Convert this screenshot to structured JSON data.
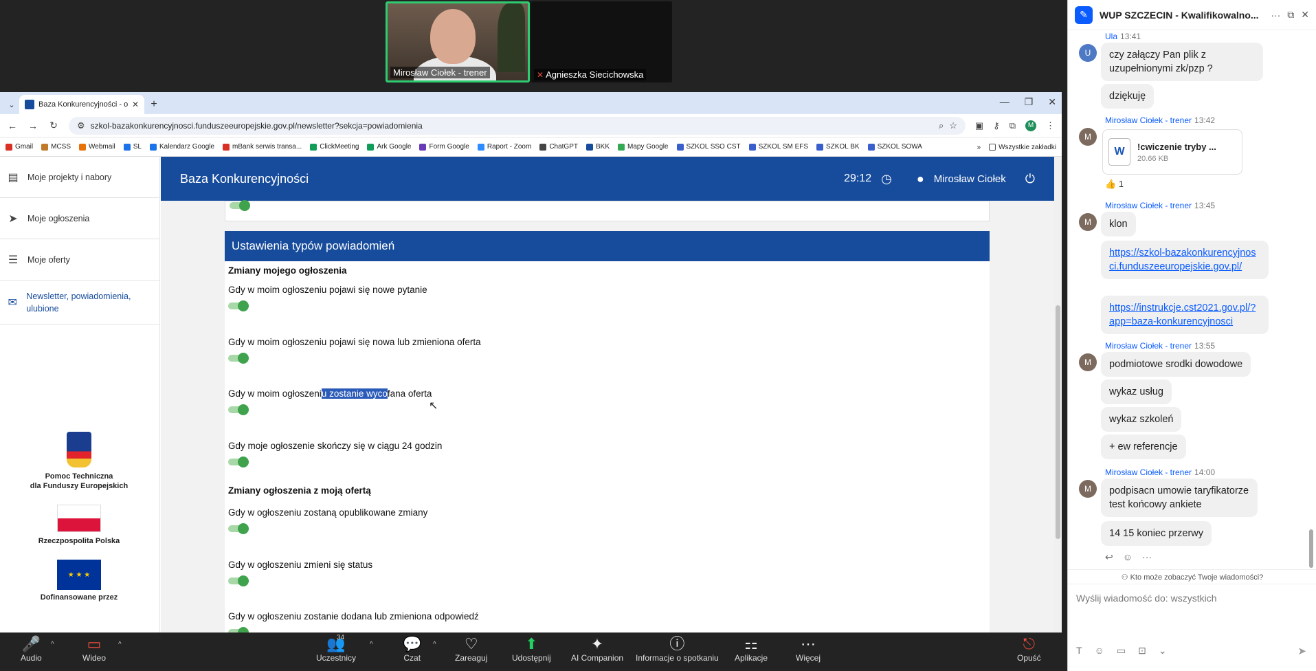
{
  "video": {
    "tile1_name": "Mirosław Ciołek - trener",
    "tile2_name": "Agnieszka Siecichowska"
  },
  "browser": {
    "tab_title": "Baza Konkurencyjności - ogłosz",
    "url": "szkol-bazakonkurencyjnosci.funduszeeuropejskie.gov.pl/newsletter?sekcja=powiadomienia",
    "bookmarks": [
      "Gmail",
      "MCSS",
      "Webmail",
      "SL",
      "Kalendarz Google",
      "mBank serwis transa...",
      "ClickMeeting",
      "Ark Google",
      "Form Google",
      "Raport - Zoom",
      "ChatGPT",
      "BKK",
      "Mapy Google",
      "SZKOL SSO CST",
      "SZKOL SM EFS",
      "SZKOL BK",
      "SZKOL SOWA"
    ],
    "bookmarks_overflow": "»",
    "all_bookmarks": "Wszystkie zakładki"
  },
  "sidebar": {
    "items": [
      {
        "label": "Moje projekty i nabory",
        "icon": "projects-icon"
      },
      {
        "label": "Moje ogłoszenia",
        "icon": "send-icon"
      },
      {
        "label": "Moje oferty",
        "icon": "list-icon"
      },
      {
        "label": "Newsletter, powiadomienia, ulubione",
        "icon": "mail-icon"
      }
    ],
    "logos": {
      "pt_line1": "Pomoc Techniczna",
      "pt_line2": "dla Funduszy Europejskich",
      "rp": "Rzeczpospolita Polska",
      "eu": "Dofinansowane przez"
    }
  },
  "header": {
    "title": "Baza Konkurencyjności",
    "timer": "29:12",
    "user": "Mirosław Ciołek"
  },
  "section": {
    "title": "Ustawienia typów powiadomień",
    "group1": "Zmiany mojego ogłoszenia",
    "group2": "Zmiany ogłoszenia z moją ofertą",
    "items": [
      "Gdy w moim ogłoszeniu pojawi się nowe pytanie",
      "Gdy w moim ogłoszeniu pojawi się nowa lub zmieniona oferta",
      "Gdy w moim ogłoszeniu zostanie wycofana oferta",
      "Gdy moje ogłoszenie skończy się w ciągu 24 godzin",
      "Gdy w ogłoszeniu zostaną opublikowane zmiany",
      "Gdy w ogłoszeniu zmieni się status",
      "Gdy w ogłoszeniu zostanie dodana lub zmieniona odpowiedź"
    ],
    "highlight_pre": "Gdy w moim ogłoszeni",
    "highlight_sel": "u zostanie wyco",
    "highlight_post": "fana oferta"
  },
  "chat": {
    "title": "WUP SZCZECIN - Kwalifikowalno...",
    "m1_name": "Ula",
    "m1_time": "13:41",
    "m1_text": "czy załączy Pan plik z uzupełnionymi zk/pzp ?",
    "m1b_text": "dziękuję",
    "m2_name": "Mirosław Ciołek - trener",
    "m2_time": "13:42",
    "file_name": "!cwiczenie tryby ...",
    "file_size": "20.66 KB",
    "reaction": "👍 1",
    "m3_name": "Mirosław Ciołek - trener",
    "m3_time": "13:45",
    "m3_text": "klon",
    "link1": "https://szkol-bazakonkurencyjnosci.funduszeeuropejskie.gov.pl/",
    "link2": "https://instrukcje.cst2021.gov.pl/?app=baza-konkurencyjnosci",
    "m4_name": "Mirosław Ciołek - trener",
    "m4_time": "13:55",
    "m4_texts": [
      "podmiotowe srodki dowodowe",
      "wykaz usług",
      "wykaz szkoleń",
      "+ ew referencje"
    ],
    "m5_name": "Mirosław Ciołek - trener",
    "m5_time": "14:00",
    "m5_text1": "podpisacn umowie taryfikatorze test końcowy ankiete",
    "m5_text2": "14 15 koniec przerwy",
    "who_sees": "Kto może zobaczyć Twoje wiadomości?",
    "input_placeholder": "Wyślij wiadomość do: wszystkich"
  },
  "toolbar": {
    "audio": "Audio",
    "video": "Wideo",
    "participants": "Uczestnicy",
    "participants_count": "34",
    "chat": "Czat",
    "react": "Zareaguj",
    "share": "Udostępnij",
    "ai": "AI Companion",
    "info": "Informacje o spotkaniu",
    "apps": "Aplikacje",
    "more": "Więcej",
    "leave": "Opuść"
  }
}
